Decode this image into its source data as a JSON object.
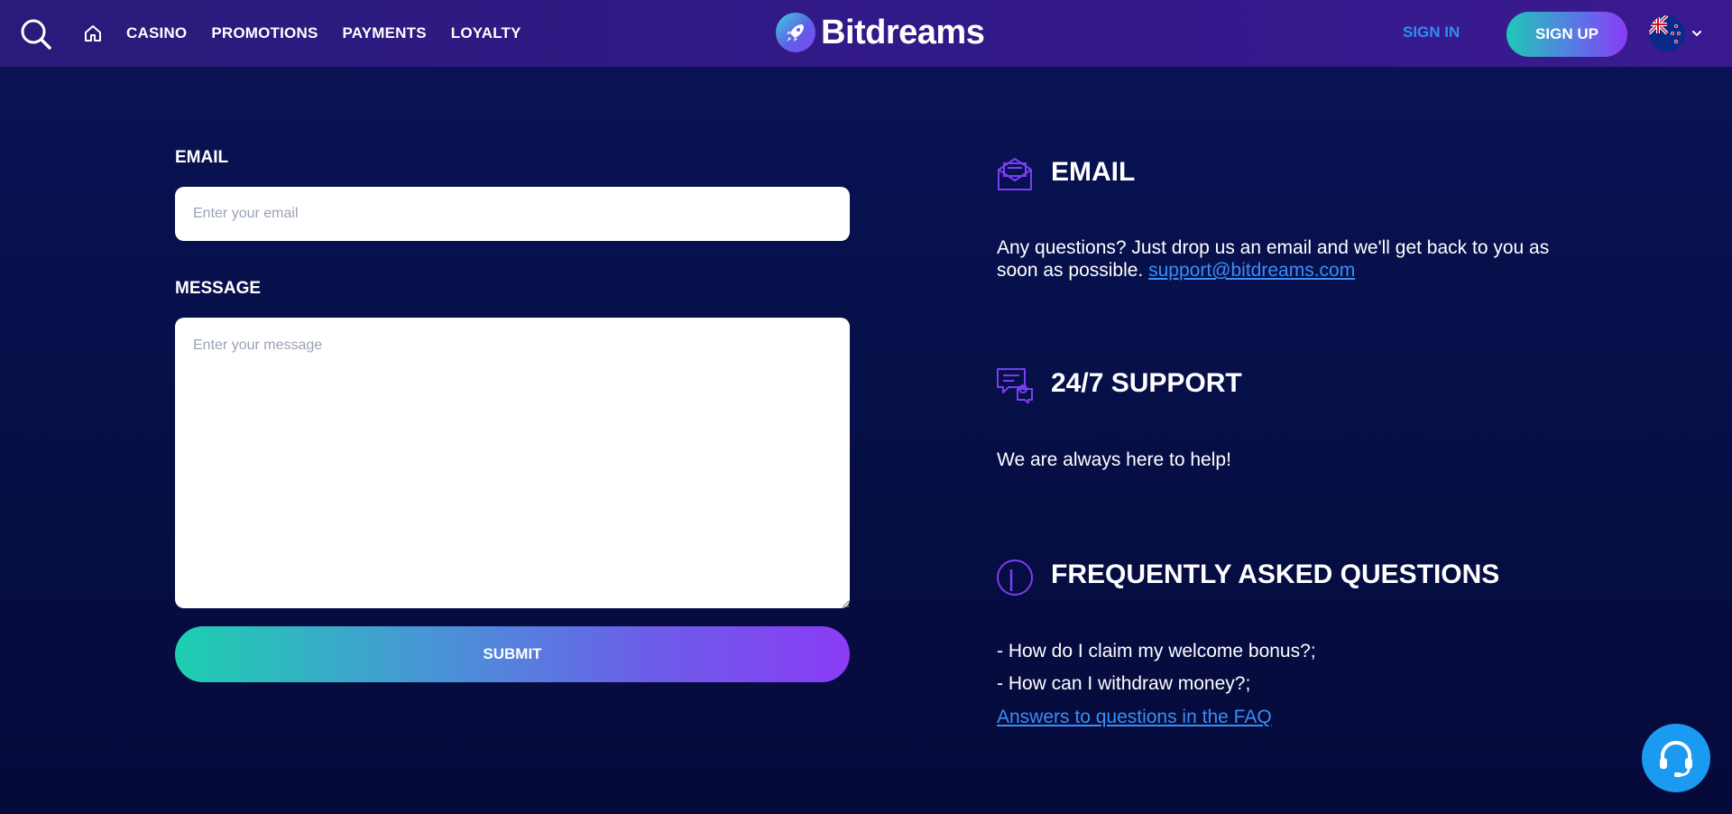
{
  "header": {
    "nav": {
      "casino": "CASINO",
      "promotions": "PROMOTIONS",
      "payments": "PAYMENTS",
      "loyalty": "LOYALTY"
    },
    "logo_text": "Bitdreams",
    "sign_in": "SIGN IN",
    "sign_up": "SIGN UP",
    "language_flag": "new-zealand-flag-icon"
  },
  "form": {
    "email_label": "EMAIL",
    "email_placeholder": "Enter your email",
    "message_label": "MESSAGE",
    "message_placeholder": "Enter your message",
    "submit_label": "SUBMIT"
  },
  "info": {
    "email": {
      "title": "EMAIL",
      "text": "Any questions? Just drop us an email and we'll get back to you as soon as possible.",
      "link": "support@bitdreams.com"
    },
    "support": {
      "title": "24/7 SUPPORT",
      "text": "We are always here to help!"
    },
    "faq": {
      "title": "FREQUENTLY ASKED QUESTIONS",
      "q1": "- How do I claim my welcome bonus?;",
      "q2": "- How can I withdraw money?;",
      "link": "Answers to questions in the FAQ"
    }
  },
  "colors": {
    "accent_blue": "#2f8df5",
    "accent_purple": "#8b3bf6",
    "accent_teal": "#1ec9b8",
    "background": "#07104a"
  }
}
